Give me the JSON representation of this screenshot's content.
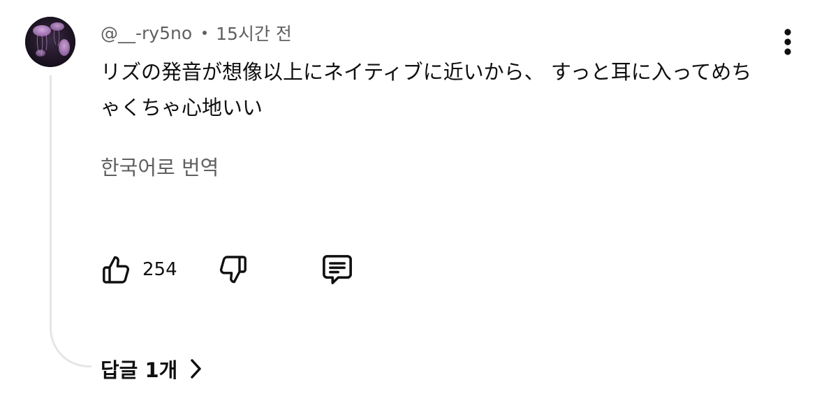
{
  "comment": {
    "author": "@__-ry5no",
    "timestamp": "15시간 전",
    "text": "リズの発音が想像以上にネイティブに近いから、 すっと耳に入ってめちゃくちゃ心地いい",
    "translate_label": "한국어로 번역",
    "like_count": "254",
    "replies_label": "답글 1개"
  },
  "icons": {
    "avatar": "jellyfish-avatar",
    "more": "more-vertical-icon",
    "like": "thumbs-up-icon",
    "dislike": "thumbs-down-icon",
    "reply": "comment-icon",
    "replies": "chevron-right-icon"
  },
  "colors": {
    "text": "#0f0f0f",
    "secondary": "#606060",
    "thread_line": "#e5e5e5"
  }
}
